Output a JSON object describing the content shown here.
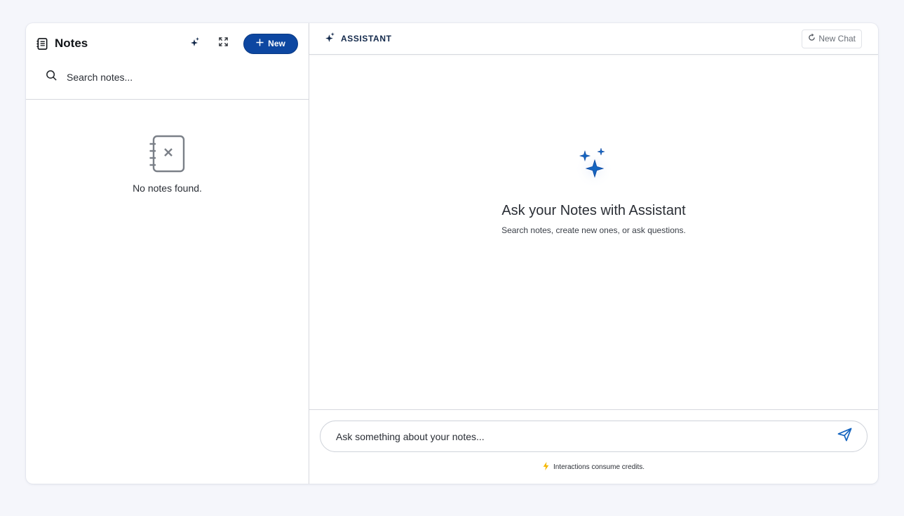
{
  "notes_panel": {
    "title": "Notes",
    "new_button_label": "New",
    "search_placeholder": "Search notes...",
    "empty_message": "No notes found.",
    "icons": {
      "title_icon": "notes-list-icon",
      "sparkle": "sparkle-icon",
      "expand": "expand-icon",
      "plus": "plus-icon",
      "search": "search-icon",
      "empty": "notebook-x-icon"
    }
  },
  "assistant": {
    "title": "ASSISTANT",
    "new_chat_label": "New Chat",
    "welcome_heading": "Ask your Notes with Assistant",
    "welcome_subtitle": "Search notes, create new ones, or ask questions.",
    "input_placeholder": "Ask something about your notes...",
    "credits_note": "Interactions consume credits.",
    "icons": {
      "title_icon": "sparkle-icon",
      "new_chat": "refresh-icon",
      "hero": "sparkles-icon",
      "send": "send-icon",
      "credits": "lightning-icon"
    }
  },
  "colors": {
    "primary": "#0d47a1",
    "sparkle_blue": "#1565c0",
    "accent_bolt": "#f5b800",
    "background": "#f5f6fb"
  }
}
